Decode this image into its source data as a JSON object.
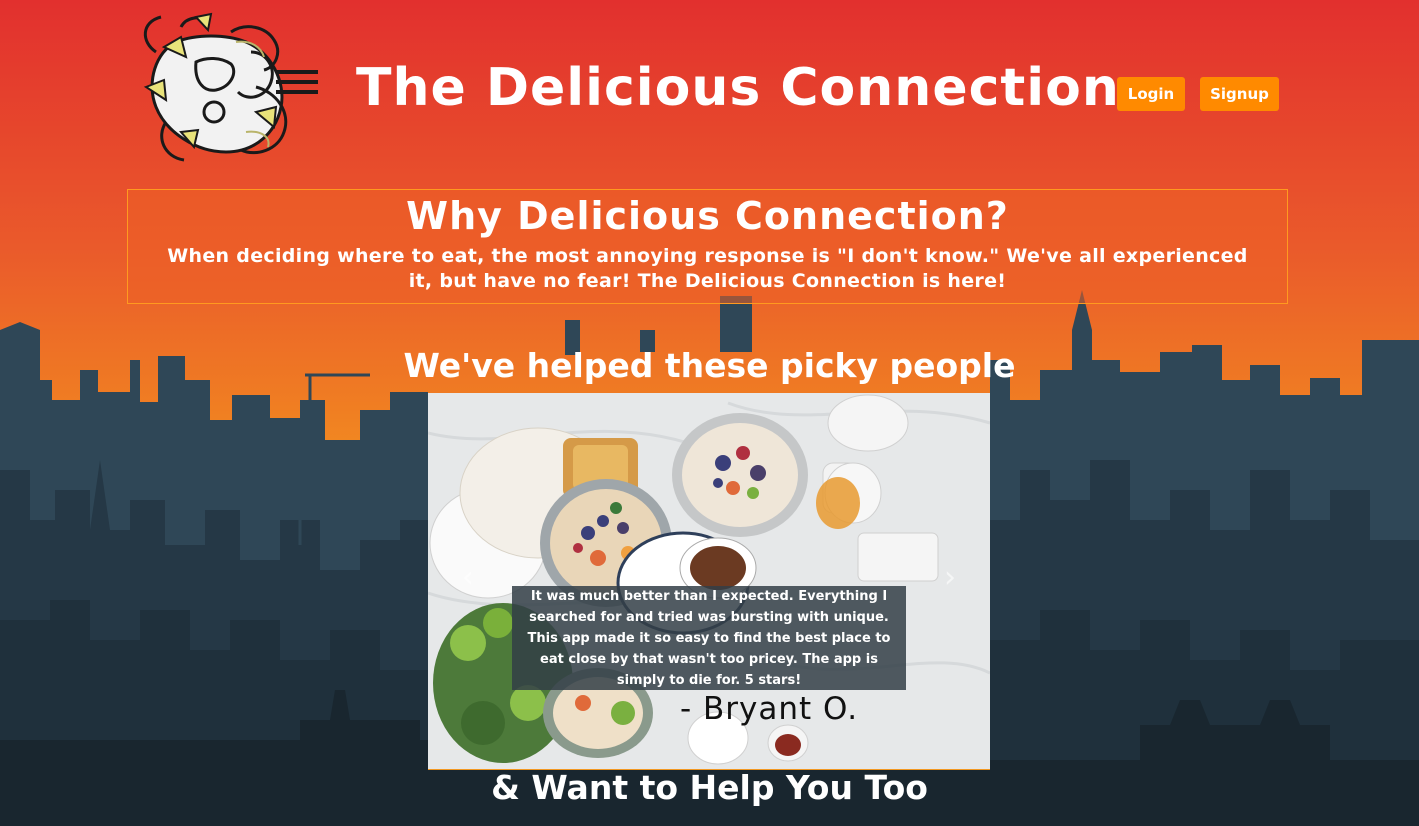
{
  "site": {
    "title": "The Delicious Connection",
    "logo_icon": "pasta-face-logo-icon"
  },
  "header": {
    "login_label": "Login",
    "signup_label": "Signup"
  },
  "why": {
    "title": "Why Delicious Connection?",
    "text": "When deciding where to eat, the most annoying response is \"I don't know.\" We've all experienced it, but have no fear! The Delicious Connection is here!"
  },
  "testimonials": {
    "heading": "We've helped these picky people",
    "current_review": "It was much better than I expected. Everything I searched for and tried was bursting with unique. This app made it so easy to find the best place to eat close by that wasn't too pricey. The app is simply to die for. 5 stars!",
    "current_reviewer": "- Bryant O.",
    "prev_icon": "chevron-left-icon",
    "next_icon": "chevron-right-icon",
    "prev_glyph": "‹",
    "next_glyph": "›"
  },
  "footer_heading": "& Want to Help You Too",
  "colors": {
    "gradient_top": "#e2302e",
    "gradient_bottom": "#f29a22",
    "skyline": "#2d4352",
    "button": "#ff8a00",
    "panel_border": "#ff9a1f"
  }
}
